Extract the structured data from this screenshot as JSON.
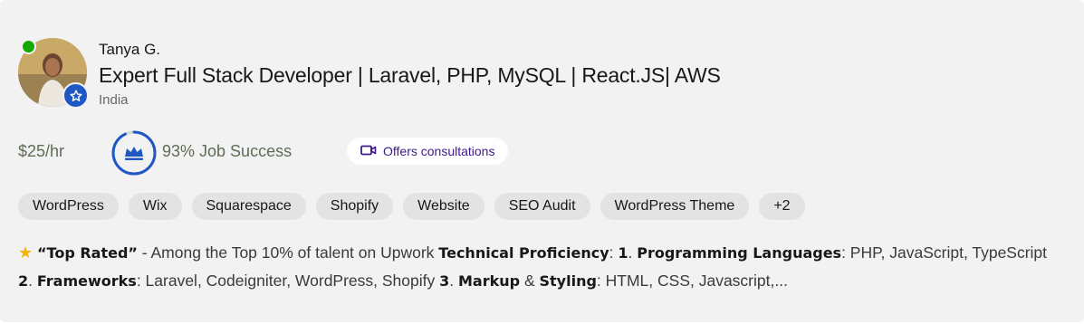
{
  "freelancer": {
    "name": "Tanya G.",
    "title": "Expert Full Stack Developer | Laravel, PHP, MySQL | React.JS| AWS",
    "country": "India",
    "online": true
  },
  "stats": {
    "rate": "$25/hr",
    "job_success_text": "93% Job Success",
    "job_success_value": 93,
    "consult_label": "Offers consultations"
  },
  "skills": [
    "WordPress",
    "Wix",
    "Squarespace",
    "Shopify",
    "Website",
    "SEO Audit",
    "WordPress Theme",
    "+2"
  ],
  "description": {
    "top_rated": "“Top Rated”",
    "t1": " - Among the Top 10% of talent on Upwork ",
    "b1": "Technical Proficiency",
    "t2": ": ",
    "b2": "1",
    "t3": ". ",
    "b3": "Programming Languages",
    "t4": ": PHP, JavaScript, TypeScript ",
    "b4": "2",
    "t5": ". ",
    "b5": "Frameworks",
    "t6": ": Laravel, Codeigniter, WordPress, Shopify ",
    "b6": "3",
    "t7": ". ",
    "b7": "Markup",
    "t8": " & ",
    "b8": "Styling",
    "t9": ": HTML, CSS, Javascript,..."
  },
  "colors": {
    "online": "#14a800",
    "badge": "#1f57c3",
    "ring": "#1f57c3",
    "consult_text": "#3c1a8a",
    "star": "#f4b400"
  },
  "icons": {
    "badge": "star-badge-icon",
    "ring_center": "crown-icon",
    "consult": "video-camera-icon",
    "desc_star": "star-icon"
  }
}
